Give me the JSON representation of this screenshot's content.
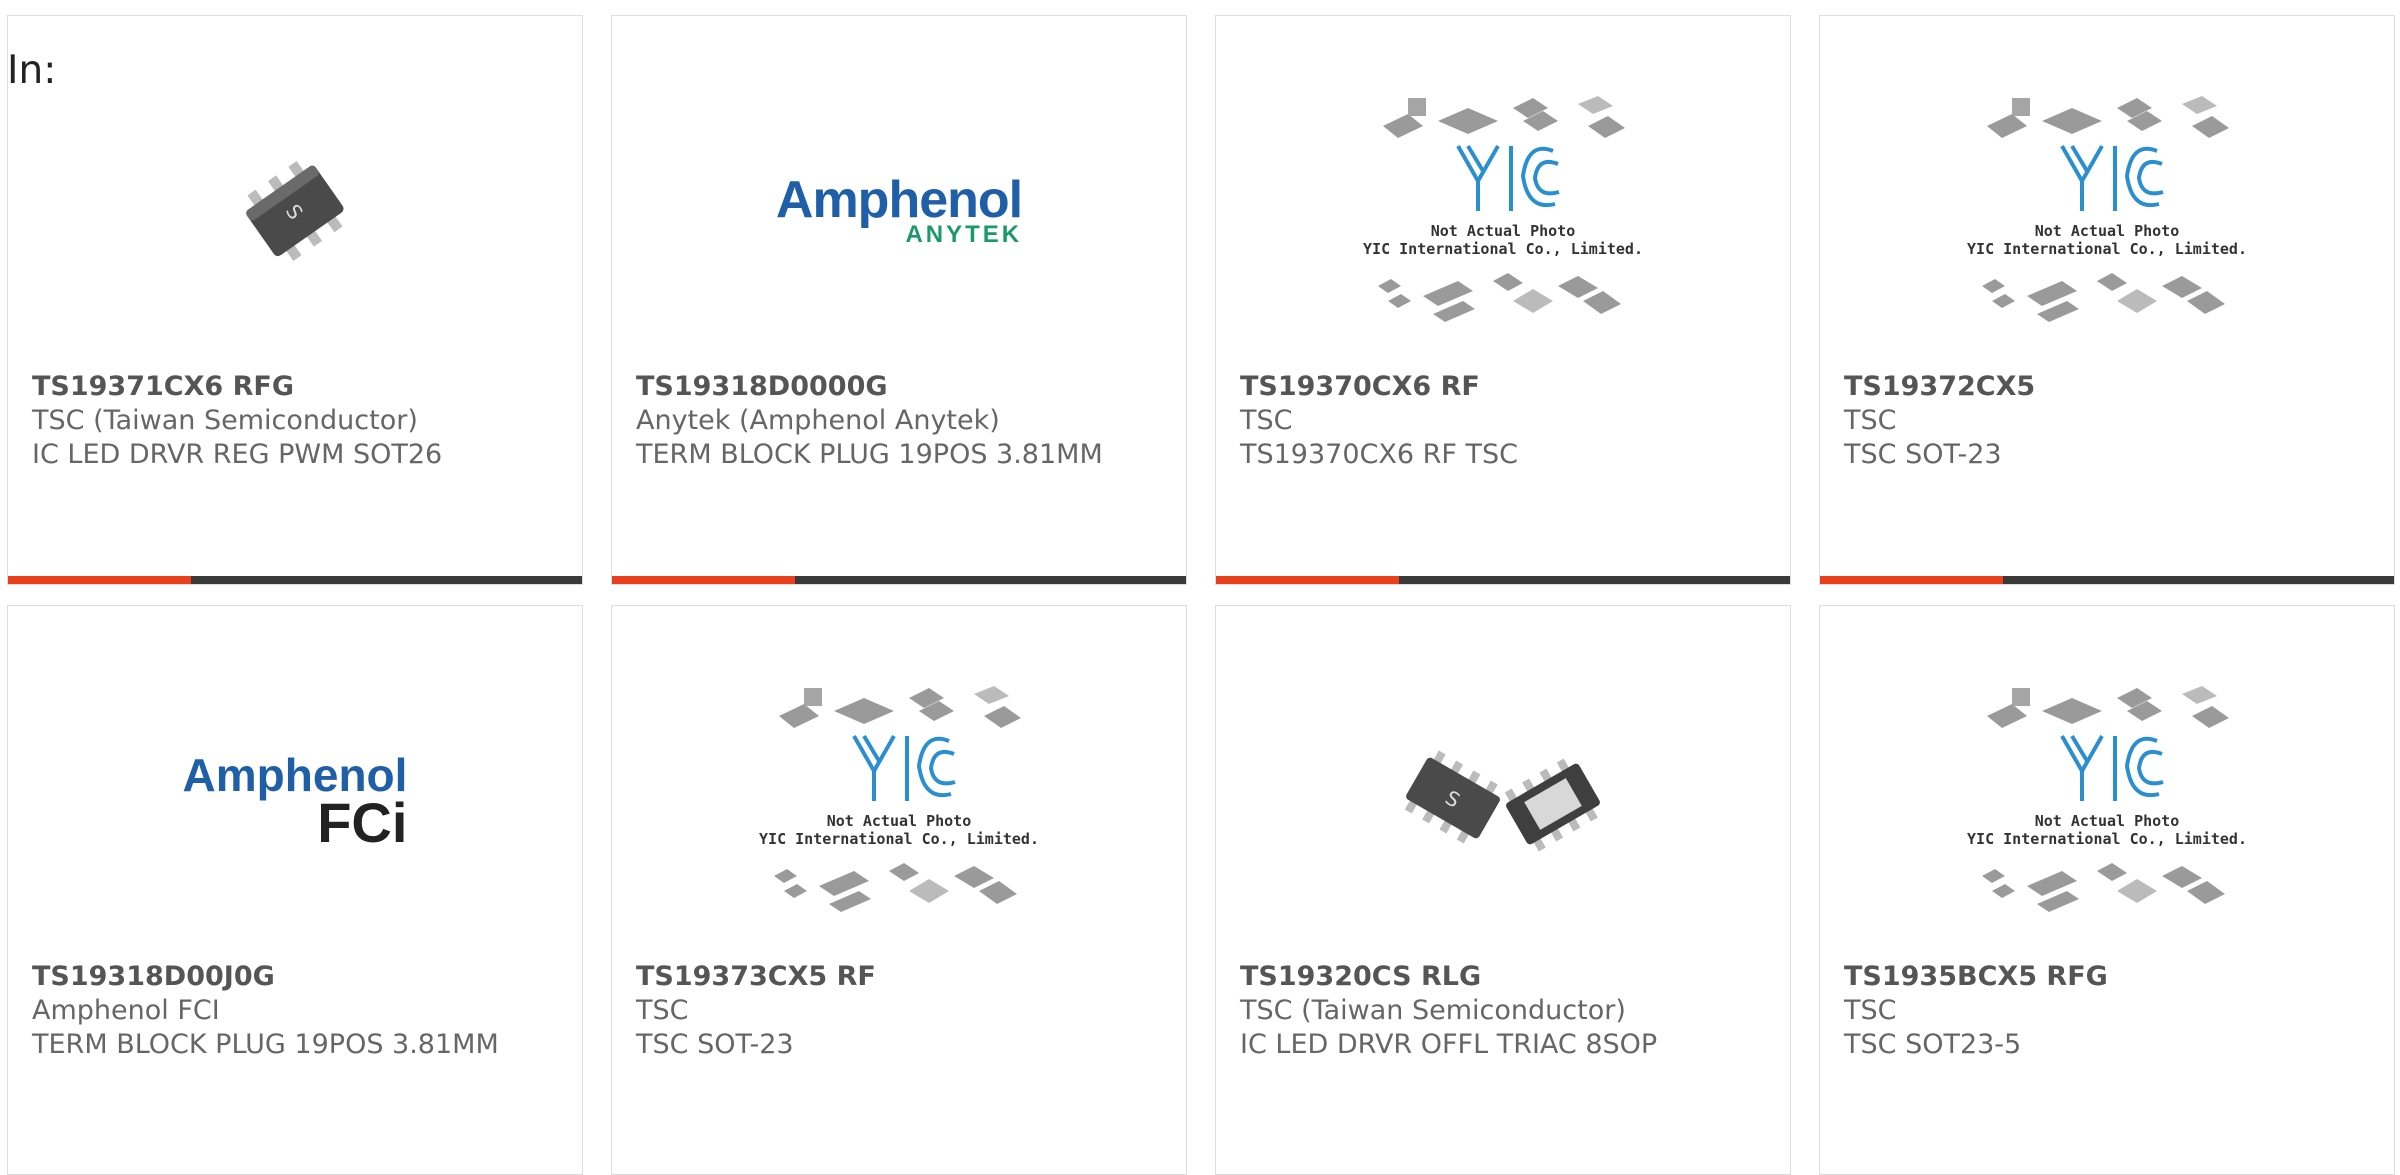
{
  "filter": {
    "label": "In:"
  },
  "cards": [
    {
      "part": "TS19371CX6 RFG",
      "manufacturer": "TSC (Taiwan Semiconductor)",
      "description": "IC LED DRVR REG PWM SOT26",
      "image": "sot26-chip-photo"
    },
    {
      "part": "TS19318D0000G",
      "manufacturer": "Anytek (Amphenol Anytek)",
      "description": "TERM BLOCK PLUG 19POS 3.81MM",
      "image": "amphenol-anytek-logo",
      "logo_line1": "Amphenol",
      "logo_line2": "ANYTEK"
    },
    {
      "part": "TS19370CX6 RF",
      "manufacturer": "TSC",
      "description": "TS19370CX6 RF TSC",
      "image": "yic-placeholder",
      "caption1": "Not Actual Photo",
      "caption2": "YIC International Co., Limited."
    },
    {
      "part": "TS19372CX5",
      "manufacturer": "TSC",
      "description": "TSC SOT-23",
      "image": "yic-placeholder",
      "caption1": "Not Actual Photo",
      "caption2": "YIC International Co., Limited."
    },
    {
      "part": "TS19318D00J0G",
      "manufacturer": "Amphenol FCI",
      "description": "TERM BLOCK PLUG 19POS 3.81MM",
      "image": "amphenol-fci-logo",
      "logo_line1": "Amphenol",
      "logo_line2": "FCi"
    },
    {
      "part": "TS19373CX5 RF",
      "manufacturer": "TSC",
      "description": "TSC SOT-23",
      "image": "yic-placeholder",
      "caption1": "Not Actual Photo",
      "caption2": "YIC International Co., Limited."
    },
    {
      "part": "TS19320CS RLG",
      "manufacturer": "TSC (Taiwan Semiconductor)",
      "description": "IC LED DRVR OFFL TRIAC 8SOP",
      "image": "sop8-chip-photo"
    },
    {
      "part": "TS1935BCX5 RFG",
      "manufacturer": "TSC",
      "description": "TSC SOT23-5",
      "image": "yic-placeholder",
      "caption1": "Not Actual Photo",
      "caption2": "YIC International Co., Limited."
    }
  ],
  "colors": {
    "accent": "#e8401c",
    "bar": "#3a3a3a",
    "border": "#dddddd",
    "yic_blue": "#2a8fd0"
  }
}
